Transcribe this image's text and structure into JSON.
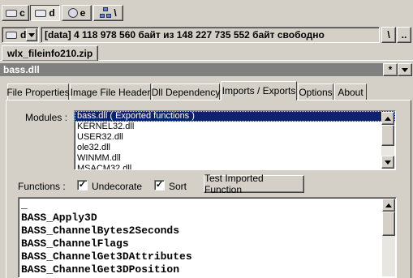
{
  "drives": [
    {
      "letter": "c",
      "icon": "hard-drive-icon",
      "pressed": false
    },
    {
      "letter": "d",
      "icon": "hard-drive-icon",
      "pressed": true
    },
    {
      "letter": "e",
      "icon": "cd-drive-icon",
      "pressed": false
    },
    {
      "letter": "\\",
      "icon": "network-icon",
      "pressed": false
    }
  ],
  "pathbar": {
    "drive_letter": "d",
    "text": "[data]  4 118 978 560 байт из 148 227 735 552 байт свободно",
    "root_label": "\\",
    "up_label": ".."
  },
  "file_tab": {
    "label": "wlx_fileinfo210.zip"
  },
  "title_bar": {
    "title": "bass.dll",
    "star_label": "*"
  },
  "tabs": [
    {
      "label": "File Properties",
      "active": false
    },
    {
      "label": "Image File Header",
      "active": false
    },
    {
      "label": "Dll Dependency",
      "active": false
    },
    {
      "label": "Imports / Exports",
      "active": true
    },
    {
      "label": "Options",
      "active": false
    },
    {
      "label": "About",
      "active": false
    }
  ],
  "modules": {
    "label": "Modules :",
    "items": [
      "bass.dll  ( Exported functions )",
      "KERNEL32.dll",
      "USER32.dll",
      "ole32.dll",
      "WINMM.dll",
      "MSACM32.dll"
    ],
    "selected_index": 0
  },
  "functions": {
    "label": "Functions :",
    "undecorate": {
      "label": "Undecorate",
      "checked": true
    },
    "sort": {
      "label": "Sort",
      "checked": true
    },
    "test_button_label": "Test Imported Function",
    "items": [
      "_",
      "BASS_Apply3D",
      "BASS_ChannelBytes2Seconds",
      "BASS_ChannelFlags",
      "BASS_ChannelGet3DAttributes",
      "BASS_ChannelGet3DPosition"
    ]
  },
  "colors": {
    "selection": "#0a246a",
    "face": "#d4d0c8",
    "titlebar": "#808080"
  }
}
